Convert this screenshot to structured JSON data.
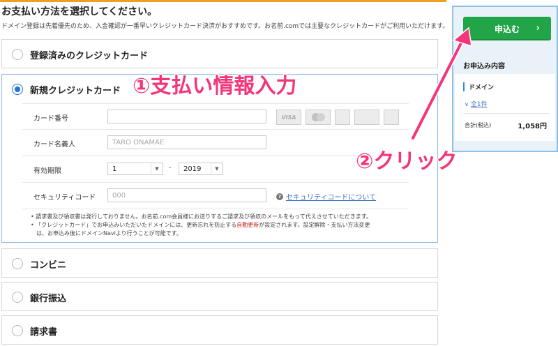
{
  "page": {
    "heading": "お支払い方法を選択してください。",
    "subtext": "ドメイン登録は先着優先のため、入金確認が一番早いクレジットカード決済がおすすめです。お名前.comでは主要なクレジットカードがご利用いただけます。"
  },
  "methods": {
    "registered_card": "登録済みのクレジットカード",
    "new_card": "新規クレジットカード",
    "convenience": "コンビニ",
    "bank": "銀行振込",
    "invoice": "請求書"
  },
  "form": {
    "card_number_label": "カード番号",
    "card_number_value": "",
    "card_name_label": "カード名義人",
    "card_name_placeholder": "TARO ONAMAE",
    "expiry_label": "有効期限",
    "expiry_month": "1",
    "expiry_separator": "-",
    "expiry_year": "2019",
    "security_label": "セキュリティコード",
    "security_placeholder": "000",
    "security_help": "セキュリティコードについて",
    "help_mark": "?"
  },
  "card_logos": [
    "VISA",
    "",
    "",
    "",
    ""
  ],
  "notes": {
    "line1": "• 請求書及び領収書は発行しておりません。お名前.com会員様にお送りするご請求及び領収のメールをもって代えさせていただきます。",
    "line2_before": "• 「クレジットカード」でお申込みいただいたドメインには、更新忘れを防止する",
    "line2_red": "自動更新",
    "line2_after": "が設定されます。設定解除・支払い方法変更",
    "line3": "は、お申込み後にドメインNaviより行うことが可能です。"
  },
  "sidebar": {
    "apply_label": "申込む",
    "apply_chevron": "›",
    "summary_title": "お申込み内容",
    "domain_label": "ドメイン",
    "domain_count_link": "全1件",
    "total_label": "合計(税込)",
    "total_value": "1,058円"
  },
  "annotations": {
    "step1": "①支払い情報入力",
    "step2": "②クリック"
  },
  "colors": {
    "accent_green": "#21a548",
    "annotation_pink": "#f4357a",
    "link_blue": "#3a70c9",
    "radio_blue": "#1a73d9",
    "top_rule_orange": "#f0a020"
  }
}
